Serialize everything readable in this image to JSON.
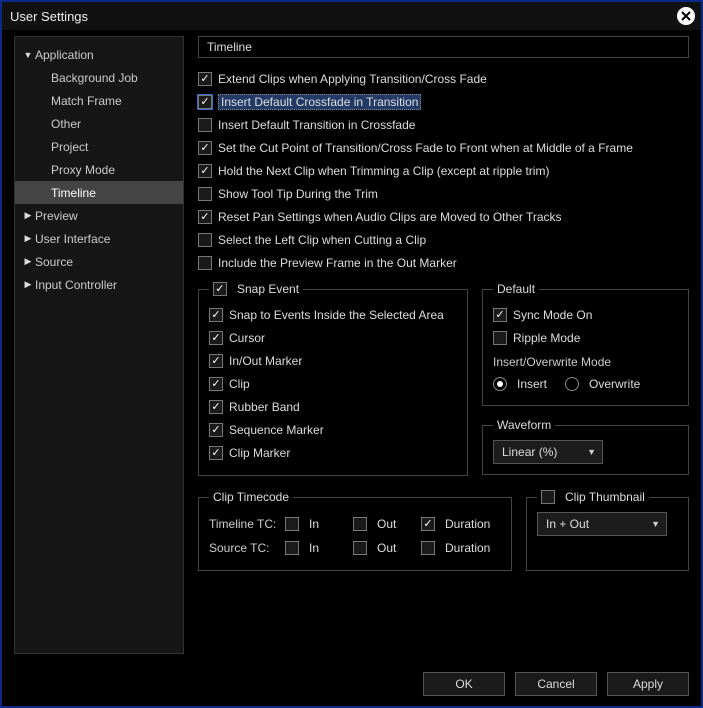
{
  "window": {
    "title": "User Settings"
  },
  "sidebar": {
    "items": [
      {
        "label": "Application",
        "expanded": true,
        "children": [
          {
            "label": "Background Job"
          },
          {
            "label": "Match Frame"
          },
          {
            "label": "Other"
          },
          {
            "label": "Project"
          },
          {
            "label": "Proxy Mode"
          },
          {
            "label": "Timeline",
            "selected": true
          }
        ]
      },
      {
        "label": "Preview",
        "expanded": false
      },
      {
        "label": "User Interface",
        "expanded": false
      },
      {
        "label": "Source",
        "expanded": false
      },
      {
        "label": "Input Controller",
        "expanded": false
      }
    ]
  },
  "breadcrumb": "Timeline",
  "options": {
    "extend_clips": "Extend Clips when Applying Transition/Cross Fade",
    "insert_crossfade": "Insert Default Crossfade in Transition",
    "insert_transition": "Insert Default Transition in Crossfade",
    "cut_point": "Set the Cut Point of Transition/Cross Fade to Front when at Middle of a Frame",
    "hold_next": "Hold the Next Clip when Trimming a Clip (except at ripple trim)",
    "show_tooltip": "Show Tool Tip During the Trim",
    "reset_pan": "Reset Pan Settings when Audio Clips are Moved to Other Tracks",
    "select_left": "Select the Left Clip when Cutting a Clip",
    "include_preview": "Include the Preview Frame in the Out Marker"
  },
  "snap": {
    "legend": "Snap Event",
    "items": {
      "inside": "Snap to Events Inside the Selected Area",
      "cursor": "Cursor",
      "inout": "In/Out Marker",
      "clip": "Clip",
      "rubber": "Rubber Band",
      "seqmark": "Sequence Marker",
      "clipmark": "Clip Marker"
    }
  },
  "default_group": {
    "legend": "Default",
    "sync": "Sync Mode On",
    "ripple": "Ripple Mode",
    "insert_heading": "Insert/Overwrite Mode",
    "insert": "Insert",
    "overwrite": "Overwrite"
  },
  "waveform": {
    "legend": "Waveform",
    "value": "Linear (%)"
  },
  "clip_tc": {
    "legend": "Clip Timecode",
    "timeline_label": "Timeline TC:",
    "source_label": "Source TC:",
    "in": "In",
    "out": "Out",
    "duration": "Duration"
  },
  "clip_thumb": {
    "legend": "Clip Thumbnail",
    "value": "In + Out"
  },
  "buttons": {
    "ok": "OK",
    "cancel": "Cancel",
    "apply": "Apply"
  }
}
